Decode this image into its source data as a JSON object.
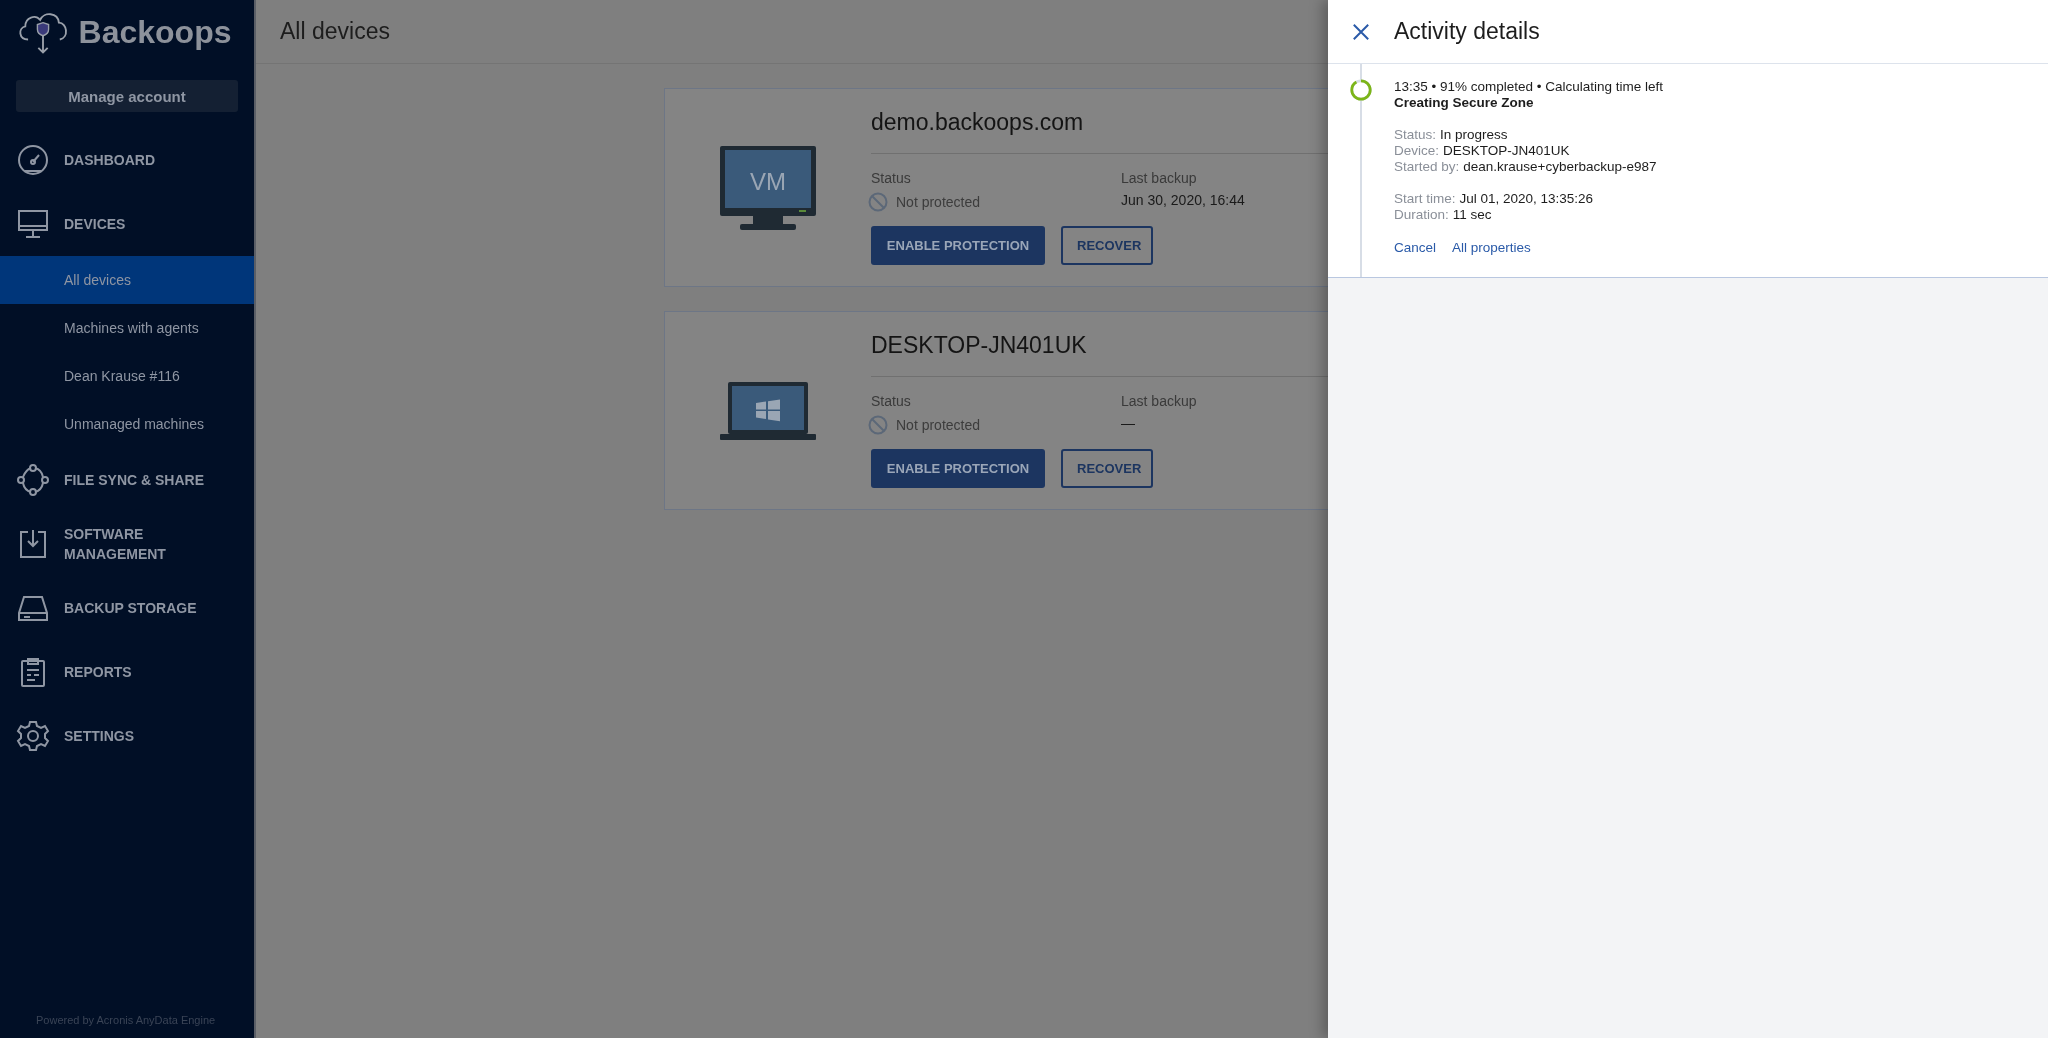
{
  "sidebar": {
    "logo": "Backoops",
    "manage_button": "Manage account",
    "items": [
      {
        "kind": "section",
        "label": "DASHBOARD"
      },
      {
        "kind": "section",
        "label": "DEVICES",
        "children": [
          {
            "label": "All devices",
            "selected": true
          },
          {
            "label": "Machines with agents",
            "selected": false
          },
          {
            "label": "Dean Krause #116",
            "selected": false
          },
          {
            "label": "Unmanaged machines",
            "selected": false
          }
        ]
      },
      {
        "kind": "section",
        "label": "FILE SYNC & SHARE"
      },
      {
        "kind": "section",
        "label": "SOFTWARE MANAGEMENT"
      },
      {
        "kind": "section",
        "label": "BACKUP STORAGE"
      },
      {
        "kind": "section",
        "label": "REPORTS"
      },
      {
        "kind": "section",
        "label": "SETTINGS"
      }
    ],
    "footer": "Powered by Acronis AnyData Engine"
  },
  "header": {
    "title": "All devices"
  },
  "devices": [
    {
      "kind": "vm",
      "screen_text": "VM",
      "name": "demo.backoops.com",
      "status_label": "Status",
      "status": "Not protected",
      "backup_label": "Last backup",
      "last_backup": "Jun 30, 2020, 16:44",
      "buttons": [
        "ENABLE PROTECTION",
        "RECOVER"
      ]
    },
    {
      "kind": "laptop",
      "name": "DESKTOP-JN401UK",
      "status_label": "Status",
      "status": "Not protected",
      "backup_label": "Last backup",
      "last_backup": "—",
      "buttons": [
        "ENABLE PROTECTION",
        "RECOVER"
      ]
    }
  ],
  "panel": {
    "title": "Activity details",
    "activity": {
      "level": 0.91,
      "summary": "13:35 • 91% completed • Calculating time left",
      "name": "Creating Secure Zone",
      "groups": [
        [
          {
            "label": "Status:",
            "value": "In progress"
          },
          {
            "label": "Device:",
            "value": "DESKTOP-JN401UK"
          },
          {
            "label": "Started by:",
            "value": "dean.krause+cyberbackup-e987"
          }
        ],
        [
          {
            "label": "Start time:",
            "value": "Jul 01, 2020, 13:35:26"
          },
          {
            "label": "Duration:",
            "value": "11 sec"
          }
        ]
      ],
      "links": [
        "Cancel",
        "All properties"
      ]
    }
  }
}
